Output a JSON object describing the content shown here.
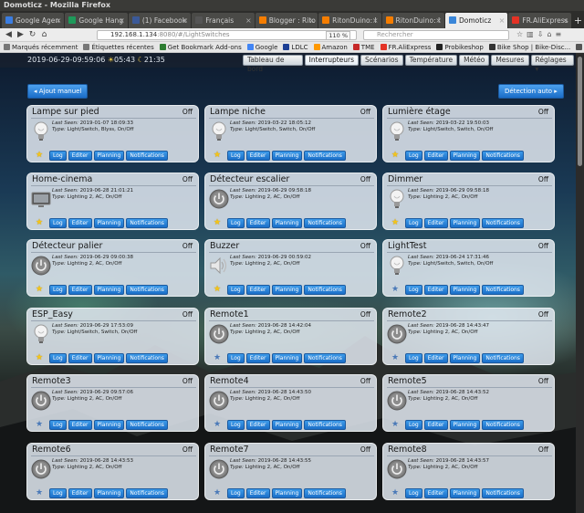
{
  "window": {
    "title": "Domoticz - Mozilla Firefox"
  },
  "tabs": [
    {
      "label": "Google Agen",
      "color": "#3b7de0"
    },
    {
      "label": "Google Hang",
      "color": "#1e9a5a"
    },
    {
      "label": "(1) Facebook",
      "color": "#3b5998"
    },
    {
      "label": "Français",
      "color": "#555555"
    },
    {
      "label": "Blogger : Rito",
      "color": "#f57d00"
    },
    {
      "label": "RitonDuino: I",
      "color": "#f57d00"
    },
    {
      "label": "RitonDuino: I",
      "color": "#f57d00"
    },
    {
      "label": "Domoticz",
      "color": "#3a86d9",
      "active": true
    },
    {
      "label": "FR.AliExpress",
      "color": "#e43225"
    }
  ],
  "browser": {
    "url_host": "192.168.1.134",
    "url_rest": ":8080/#/LightSwitches",
    "zoom": "110 %",
    "search_placeholder": "Rechercher"
  },
  "bookmarks": [
    {
      "label": "Marqués récemment",
      "color": "#777777"
    },
    {
      "label": "Étiquettes récentes",
      "color": "#777777"
    },
    {
      "label": "Get Bookmark Add-ons",
      "color": "#2e7d32"
    },
    {
      "label": "Google",
      "color": "#4285f4"
    },
    {
      "label": "LDLC",
      "color": "#1c3f94"
    },
    {
      "label": "Amazon",
      "color": "#ff9900"
    },
    {
      "label": "TME",
      "color": "#c62828"
    },
    {
      "label": "FR.AliExpress",
      "color": "#e43225"
    },
    {
      "label": "Probikeshop",
      "color": "#222222"
    },
    {
      "label": "Bike Shop | Bike-Disc...",
      "color": "#333333"
    },
    {
      "label": "Music-box",
      "color": "#555555"
    }
  ],
  "header": {
    "datetime": "2019-06-29-09:59:06",
    "sunrise": "05:43",
    "sunset": "21:35",
    "nav": [
      {
        "label": "Tableau de bord"
      },
      {
        "label": "Interrupteurs",
        "active": true
      },
      {
        "label": "Scénarios"
      },
      {
        "label": "Température"
      },
      {
        "label": "Météo"
      },
      {
        "label": "Mesures"
      },
      {
        "label": "Réglages ▾"
      }
    ]
  },
  "actions": {
    "add_manual": "Ajout manuel",
    "auto_detect": "Détection auto"
  },
  "labels": {
    "last_seen": "Last Seen:",
    "type": "Type:",
    "log": "Log",
    "edit": "Editer",
    "planning": "Planning",
    "notifications": "Notifications"
  },
  "devices": [
    {
      "name": "Lampe sur pied",
      "status": "Off",
      "last_seen": "2019-01-07 18:09:33",
      "type": "Light/Switch, Blyss, On/Off",
      "icon": "bulb",
      "favorite": true
    },
    {
      "name": "Lampe niche",
      "status": "Off",
      "last_seen": "2019-03-22 18:05:12",
      "type": "Light/Switch, Switch, On/Off",
      "icon": "bulb",
      "favorite": true
    },
    {
      "name": "Lumière étage",
      "status": "Off",
      "last_seen": "2019-03-22 19:50:03",
      "type": "Light/Switch, Switch, On/Off",
      "icon": "bulb",
      "favorite": true
    },
    {
      "name": "Home-cinema",
      "status": "Off",
      "last_seen": "2019-06-28 21:01:21",
      "type": "Lighting 2, AC, On/Off",
      "icon": "tv",
      "favorite": true
    },
    {
      "name": "Détecteur escalier",
      "status": "Off",
      "last_seen": "2019-06-29 09:58:18",
      "type": "Lighting 2, AC, On/Off",
      "icon": "power",
      "favorite": true
    },
    {
      "name": "Dimmer",
      "status": "Off",
      "last_seen": "2019-06-29 09:58:18",
      "type": "Lighting 2, AC, On/Off",
      "icon": "bulb",
      "favorite": true
    },
    {
      "name": "Détecteur palier",
      "status": "Off",
      "last_seen": "2019-06-29 09:00:38",
      "type": "Lighting 2, AC, On/Off",
      "icon": "power",
      "favorite": true
    },
    {
      "name": "Buzzer",
      "status": "Off",
      "last_seen": "2019-06-29 00:59:02",
      "type": "Lighting 2, AC, On/Off",
      "icon": "speaker",
      "favorite": true
    },
    {
      "name": "LightTest",
      "status": "Off",
      "last_seen": "2019-06-24 17:31:46",
      "type": "Light/Switch, Switch, On/Off",
      "icon": "bulb",
      "favorite": false
    },
    {
      "name": "ESP_Easy",
      "status": "Off",
      "last_seen": "2019-06-29 17:53:09",
      "type": "Light/Switch, Switch, On/Off",
      "icon": "bulb",
      "favorite": true
    },
    {
      "name": "Remote1",
      "status": "Off",
      "last_seen": "2019-06-28 14:42:04",
      "type": "Lighting 2, AC, On/Off",
      "icon": "power",
      "favorite": false
    },
    {
      "name": "Remote2",
      "status": "Off",
      "last_seen": "2019-06-28 14:43:47",
      "type": "Lighting 2, AC, On/Off",
      "icon": "power",
      "favorite": false
    },
    {
      "name": "Remote3",
      "status": "Off",
      "last_seen": "2019-06-29 09:57:06",
      "type": "Lighting 2, AC, On/Off",
      "icon": "power",
      "favorite": false
    },
    {
      "name": "Remote4",
      "status": "Off",
      "last_seen": "2019-06-28 14:43:50",
      "type": "Lighting 2, AC, On/Off",
      "icon": "power",
      "favorite": false
    },
    {
      "name": "Remote5",
      "status": "Off",
      "last_seen": "2019-06-28 14:43:52",
      "type": "Lighting 2, AC, On/Off",
      "icon": "power",
      "favorite": false
    },
    {
      "name": "Remote6",
      "status": "Off",
      "last_seen": "2019-06-28 14:43:53",
      "type": "Lighting 2, AC, On/Off",
      "icon": "power",
      "favorite": false
    },
    {
      "name": "Remote7",
      "status": "Off",
      "last_seen": "2019-06-28 14:43:55",
      "type": "Lighting 2, AC, On/Off",
      "icon": "power",
      "favorite": false
    },
    {
      "name": "Remote8",
      "status": "Off",
      "last_seen": "2019-06-28 14:43:57",
      "type": "Lighting 2, AC, On/Off",
      "icon": "power",
      "favorite": false
    }
  ]
}
